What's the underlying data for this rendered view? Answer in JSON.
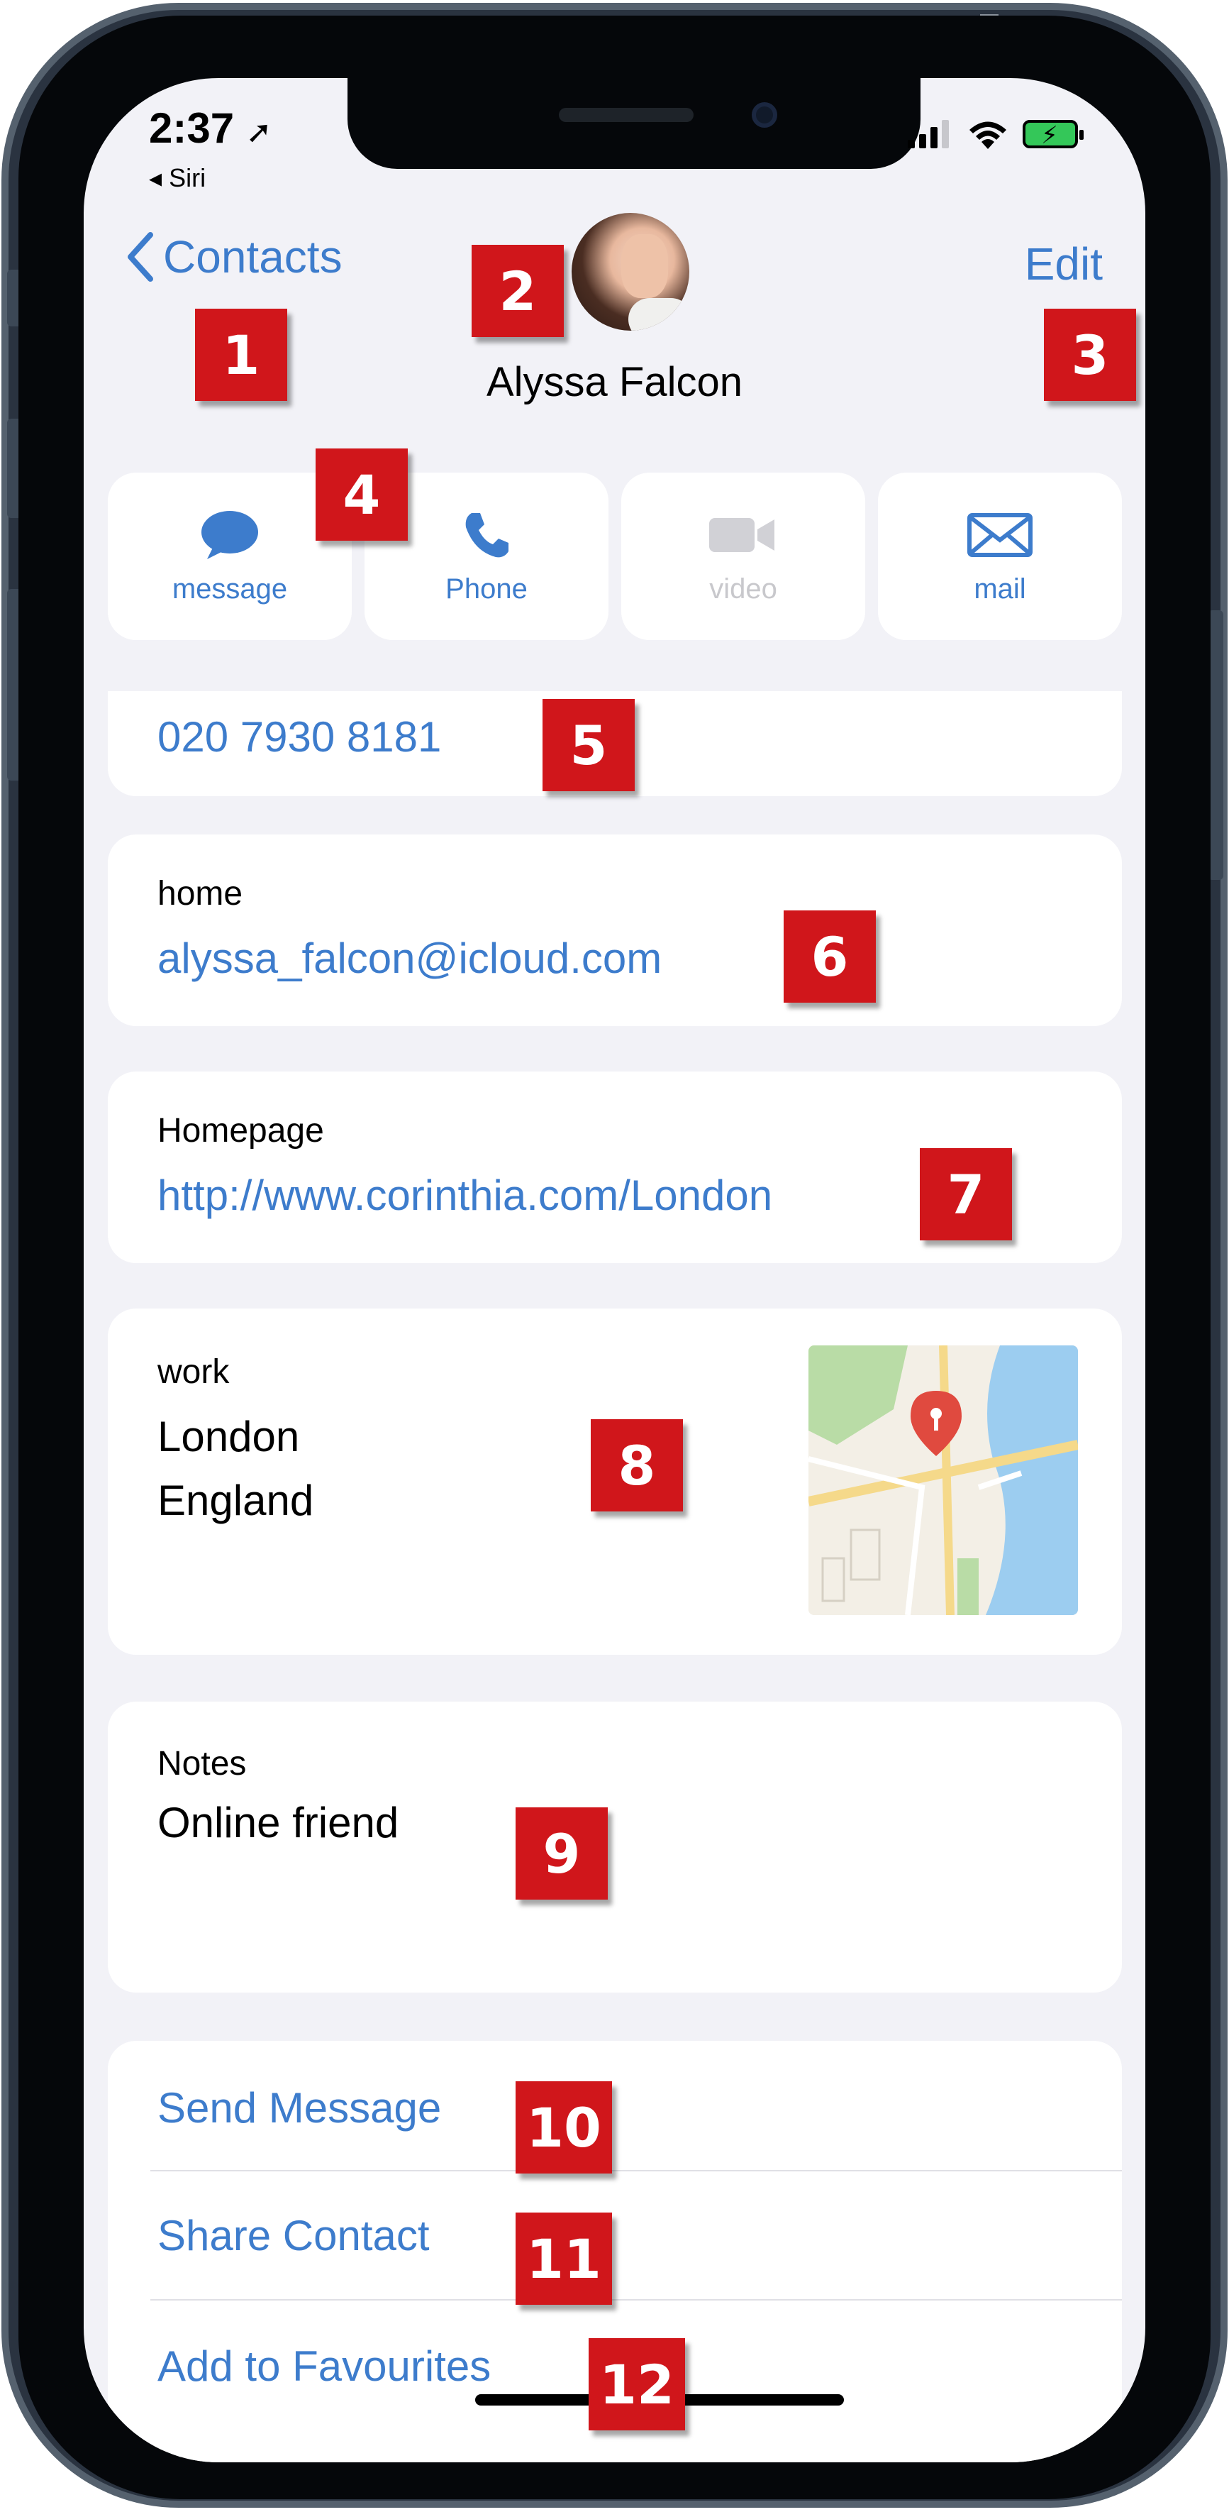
{
  "status_bar": {
    "time": "2:37",
    "back_app": "◂ Siri"
  },
  "nav": {
    "back_label": "Contacts",
    "edit_label": "Edit"
  },
  "contact": {
    "name": "Alyssa Falcon"
  },
  "actions": [
    {
      "label": "message",
      "icon": "message-bubble-icon",
      "enabled": true
    },
    {
      "label": "Phone",
      "icon": "phone-icon",
      "enabled": true
    },
    {
      "label": "video",
      "icon": "video-camera-icon",
      "enabled": false
    },
    {
      "label": "mail",
      "icon": "envelope-icon",
      "enabled": true
    }
  ],
  "phone": {
    "number": "020 7930 8181"
  },
  "email": {
    "label": "home",
    "value": "alyssa_falcon@icloud.com"
  },
  "homepage": {
    "label": "Homepage",
    "value": "http://www.corinthia.com/London"
  },
  "address": {
    "label": "work",
    "line1": "London",
    "line2": "England"
  },
  "notes": {
    "label": "Notes",
    "value": "Online friend"
  },
  "options": {
    "send_message": "Send Message",
    "share_contact": "Share Contact",
    "add_favourites": "Add to Favourites"
  },
  "badges": [
    "1",
    "2",
    "3",
    "4",
    "5",
    "6",
    "7",
    "8",
    "9",
    "10",
    "11",
    "12"
  ],
  "colors": {
    "accent": "#3d7ccc",
    "badge": "#d0161b",
    "background": "#f2f2f7"
  }
}
